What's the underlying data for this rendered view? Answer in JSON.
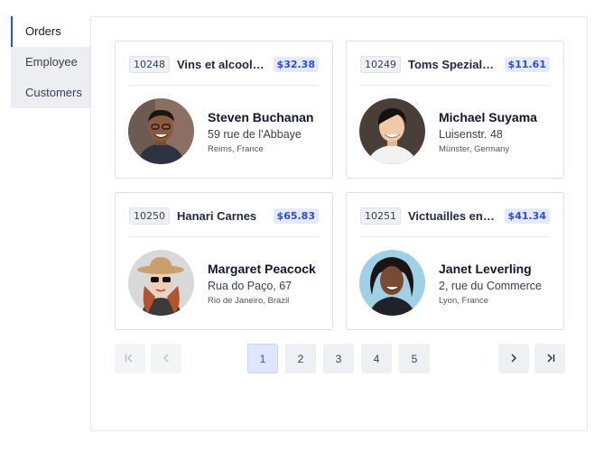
{
  "sidebar": {
    "tabs": [
      {
        "label": "Orders"
      },
      {
        "label": "Employee"
      },
      {
        "label": "Customers"
      }
    ]
  },
  "orders": [
    {
      "id": "10248",
      "ship_name": "Vins et alcools Chevalier",
      "freight": "$32.38",
      "employee": {
        "name": "Steven Buchanan",
        "address": "59 rue de l'Abbaye",
        "city": "Reims, France"
      }
    },
    {
      "id": "10249",
      "ship_name": "Toms Spezialitäten",
      "freight": "$11.61",
      "employee": {
        "name": "Michael Suyama",
        "address": "Luisenstr. 48",
        "city": "Münster, Germany"
      }
    },
    {
      "id": "10250",
      "ship_name": "Hanari Carnes",
      "freight": "$65.83",
      "employee": {
        "name": "Margaret Peacock",
        "address": "Rua do Paço, 67",
        "city": "Rio de Janeiro, Brazil"
      }
    },
    {
      "id": "10251",
      "ship_name": "Victuailles en stock",
      "freight": "$41.34",
      "employee": {
        "name": "Janet Leverling",
        "address": "2, rue du Commerce",
        "city": "Lyon, France"
      }
    }
  ],
  "pagination": {
    "pages": [
      "1",
      "2",
      "3",
      "4",
      "5"
    ],
    "current": "1",
    "icons": {
      "first": "first-page-icon",
      "prev": "chevron-left-icon",
      "next": "chevron-right-icon",
      "last": "last-page-icon"
    }
  },
  "colors": {
    "accent": "#2f4cdb",
    "freight_bg": "#e4eaff"
  }
}
